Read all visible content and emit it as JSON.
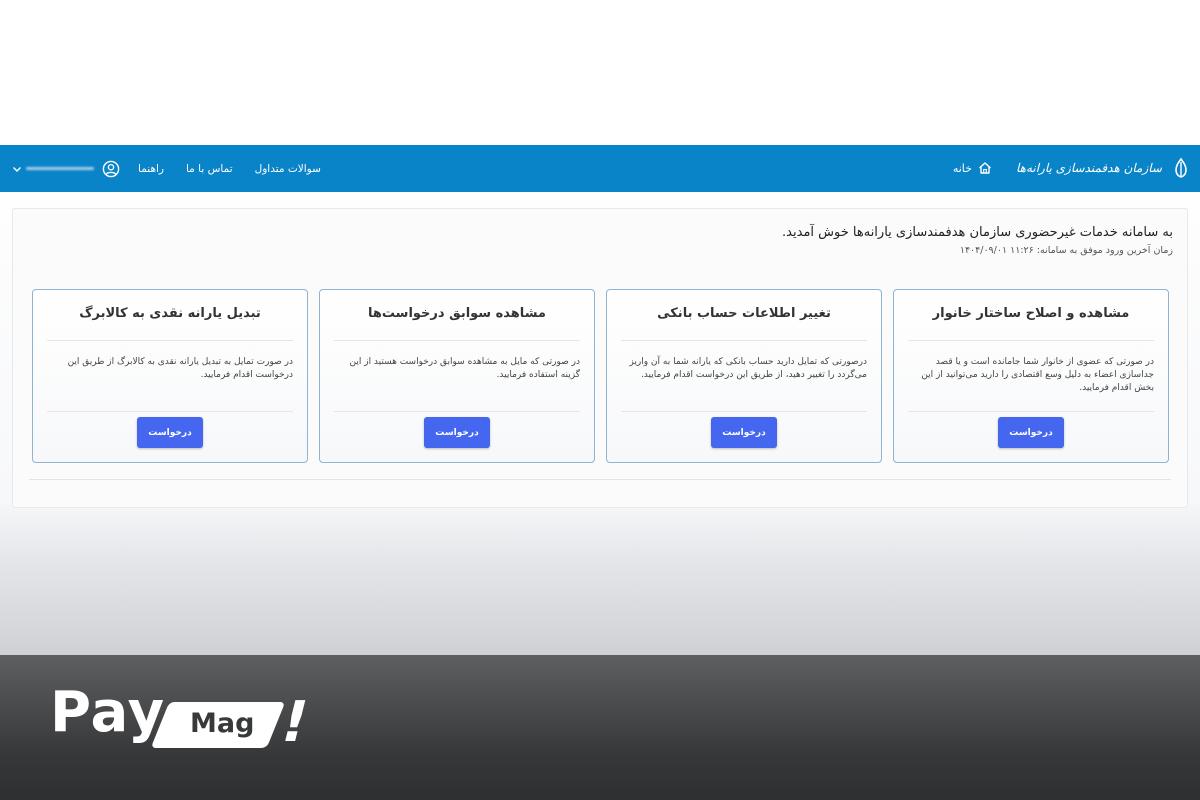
{
  "header": {
    "brand_text": "سازمان هدفمندسازی یارانه‌ها",
    "home_label": "خانه",
    "nav": {
      "faq": "سوالات متداول",
      "contact": "تماس با ما",
      "guide": "راهنما"
    }
  },
  "welcome": {
    "message": "به سامانه خدمات غیرحضوری سازمان هدفمندسازی یارانه‌ها خوش آمدید.",
    "last_login": "زمان آخرین ورود موفق به سامانه: ۱۱:۲۶   ۱۴۰۴/۰۹/۰۱"
  },
  "cards": [
    {
      "title": "مشاهده و اصلاح ساختار خانوار",
      "description": "در صورتی که عضوی از خانوار شما جامانده است و یا قصد جداسازی اعضاء به دلیل وسع اقتصادی را دارید می‌توانید از این بخش اقدام فرمایید.",
      "button": "درخواست"
    },
    {
      "title": "تغییر اطلاعات حساب بانکی",
      "description": "درصورتی که تمایل دارید حساب بانکی که یارانه شما به آن واریز می‌گردد را تغییر دهید، از طریق این درخواست اقدام فرمایید.",
      "button": "درخواست"
    },
    {
      "title": "مشاهده سوابق درخواست‌ها",
      "description": "در صورتی که مایل به مشاهده سوابق درخواست هستید از این گزینه استفاده فرمایید.",
      "button": "درخواست"
    },
    {
      "title": "تبدیل یارانه نقدی به کالابرگ",
      "description": "در صورت تمایل به تبدیل یارانه نقدی به کالابرگ از طریق این درخواست اقدام فرمایید.",
      "button": "درخواست"
    }
  ],
  "watermark": {
    "pay": "Pay",
    "mag": "Mag",
    "bang": "!"
  },
  "colors": {
    "header_bg": "#0a84c8",
    "button_bg": "#4566ee",
    "card_border": "#8fb3d3"
  }
}
